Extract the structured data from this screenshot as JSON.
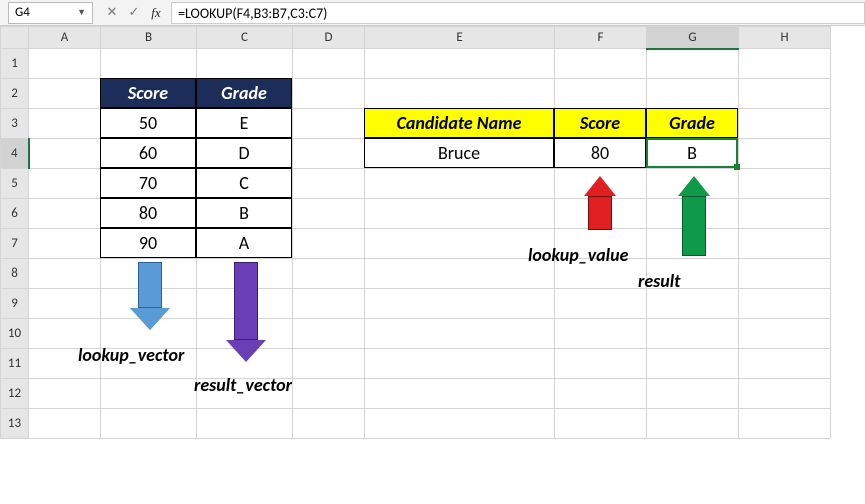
{
  "name_box": "G4",
  "formula": "=LOOKUP(F4,B3:B7,C3:C7)",
  "columns": [
    "A",
    "B",
    "C",
    "D",
    "E",
    "F",
    "G",
    "H"
  ],
  "rows": [
    "1",
    "2",
    "3",
    "4",
    "5",
    "6",
    "7",
    "8",
    "9",
    "10",
    "11",
    "12",
    "13"
  ],
  "lookup_table": {
    "headers": [
      "Score",
      "Grade"
    ],
    "rows": [
      [
        "50",
        "E"
      ],
      [
        "60",
        "D"
      ],
      [
        "70",
        "C"
      ],
      [
        "80",
        "B"
      ],
      [
        "90",
        "A"
      ]
    ]
  },
  "result_table": {
    "headers": [
      "Candidate Name",
      "Score",
      "Grade"
    ],
    "row": [
      "Bruce",
      "80",
      "B"
    ]
  },
  "annotations": {
    "lookup_vector": "lookup_vector",
    "result_vector": "result_vector",
    "lookup_value": "lookup_value",
    "result": "result"
  },
  "active_cell": "G4"
}
